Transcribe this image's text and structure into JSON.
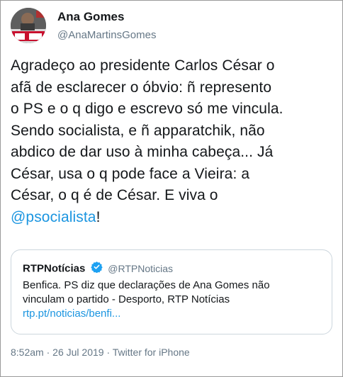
{
  "author": {
    "display_name": "Ana Gomes",
    "handle": "@AnaMartinsGomes",
    "avatar_icon": "profile-avatar"
  },
  "tweet": {
    "lines": [
      "Agradeço ao presidente Carlos César o",
      "afã de esclarecer o óbvio: ñ represento",
      "o PS e o q digo e escrevo só me vincula.",
      "Sendo socialista, e ñ apparatchik, não",
      "abdico de dar uso à minha cabeça...  Já",
      "César, usa o q pode face a Vieira: a",
      "César, o q é de César. E viva o"
    ],
    "mention": "@psocialista",
    "after_mention": "!"
  },
  "quoted": {
    "display_name": "RTPNotícias",
    "handle": "@RTPNoticias",
    "verified_icon": "verified-badge-icon",
    "text_lines": [
      "Benfica. PS diz que declarações de Ana Gomes não",
      "vinculam o partido - Desporto, RTP Notícias"
    ],
    "link": "rtp.pt/noticias/benfi..."
  },
  "meta": {
    "time": "8:52am",
    "separator1": " · ",
    "date": "26 Jul 2019",
    "separator2": " · ",
    "source": "Twitter for iPhone"
  },
  "colors": {
    "link": "#1b95e0",
    "secondary": "#657786",
    "border": "#ccd6dd",
    "verified": "#1da1f2"
  }
}
